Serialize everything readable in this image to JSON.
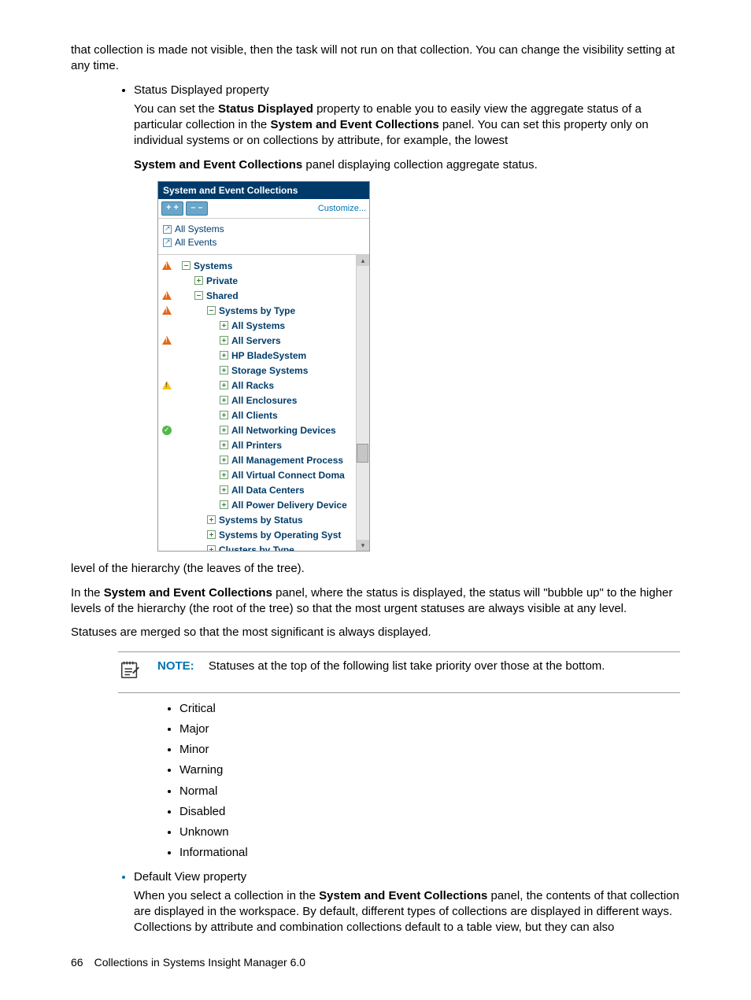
{
  "intro": {
    "p0": "that collection is made not visible, then the task will not run on that collection. You can change the visibility setting at any time."
  },
  "bullets": {
    "status_displayed": {
      "title": "Status Displayed property",
      "p1a": "You can set the ",
      "p1b": "Status Displayed",
      "p1c": " property to enable you to easily view the aggregate status of a particular collection in the ",
      "p1d": "System and Event Collections",
      "p1e": " panel. You can set this property only on individual systems or on collections by attribute, for example, the lowest",
      "p2a": "System and Event Collections",
      "p2b": " panel displaying collection aggregate status."
    },
    "default_view": {
      "title": "Default View property",
      "p1a": "When you select a collection in the ",
      "p1b": "System and Event Collections",
      "p1c": " panel, the contents of that collection are displayed in the workspace. By default, different types of collections are displayed in different ways. Collections by attribute and combination collections default to a table view, but they can also"
    }
  },
  "panel": {
    "title": "System and Event Collections",
    "btn_expand": "+ +",
    "btn_collapse": "– –",
    "customize": "Customize...",
    "top_links": [
      "All Systems",
      "All Events"
    ],
    "tree": [
      {
        "status": "critical",
        "indent": 0,
        "pm": "minus",
        "label": "Systems"
      },
      {
        "status": "",
        "indent": 1,
        "pm": "plus",
        "label": "Private"
      },
      {
        "status": "critical",
        "indent": 1,
        "pm": "minus",
        "label": "Shared"
      },
      {
        "status": "critical",
        "indent": 2,
        "pm": "minus",
        "label": "Systems by Type"
      },
      {
        "status": "",
        "indent": 3,
        "pm": "plus",
        "label": "All Systems"
      },
      {
        "status": "critical",
        "indent": 3,
        "pm": "plus",
        "label": "All Servers"
      },
      {
        "status": "",
        "indent": 3,
        "pm": "plus",
        "label": "HP BladeSystem"
      },
      {
        "status": "",
        "indent": 3,
        "pm": "plus",
        "label": "Storage Systems"
      },
      {
        "status": "warn",
        "indent": 3,
        "pm": "plus",
        "label": "All Racks"
      },
      {
        "status": "",
        "indent": 3,
        "pm": "plus",
        "label": "All Enclosures"
      },
      {
        "status": "",
        "indent": 3,
        "pm": "plus",
        "label": "All Clients"
      },
      {
        "status": "ok",
        "indent": 3,
        "pm": "plus",
        "label": "All Networking Devices"
      },
      {
        "status": "",
        "indent": 3,
        "pm": "plus",
        "label": "All Printers"
      },
      {
        "status": "",
        "indent": 3,
        "pm": "plus",
        "label": "All Management Process"
      },
      {
        "status": "",
        "indent": 3,
        "pm": "plus",
        "label": "All Virtual Connect Doma"
      },
      {
        "status": "",
        "indent": 3,
        "pm": "plus",
        "label": "All Data Centers"
      },
      {
        "status": "",
        "indent": 3,
        "pm": "plus",
        "label": "All Power Delivery Device"
      },
      {
        "status": "",
        "indent": 2,
        "pm": "plus",
        "label": "Systems by Status"
      },
      {
        "status": "",
        "indent": 2,
        "pm": "plus",
        "label": "Systems by Operating Syst"
      },
      {
        "status": "",
        "indent": 2,
        "pm": "plus",
        "label": "Clusters by Type"
      }
    ]
  },
  "after_panel": {
    "p3": "level of the hierarchy (the leaves of the tree).",
    "p4a": "In the ",
    "p4b": "System and Event Collections",
    "p4c": " panel, where the status is displayed, the status will \"bubble up\" to the higher levels of the hierarchy (the root of the tree) so that the most urgent statuses are always visible at any level.",
    "p5": "Statuses are merged so that the most significant is always displayed."
  },
  "note": {
    "label": "NOTE:",
    "text": "Statuses at the top of the following list take priority over those at the bottom."
  },
  "status_list": [
    "Critical",
    "Major",
    "Minor",
    "Warning",
    "Normal",
    "Disabled",
    "Unknown",
    "Informational"
  ],
  "footer": {
    "page": "66",
    "chapter": "Collections in Systems Insight Manager 6.0"
  }
}
